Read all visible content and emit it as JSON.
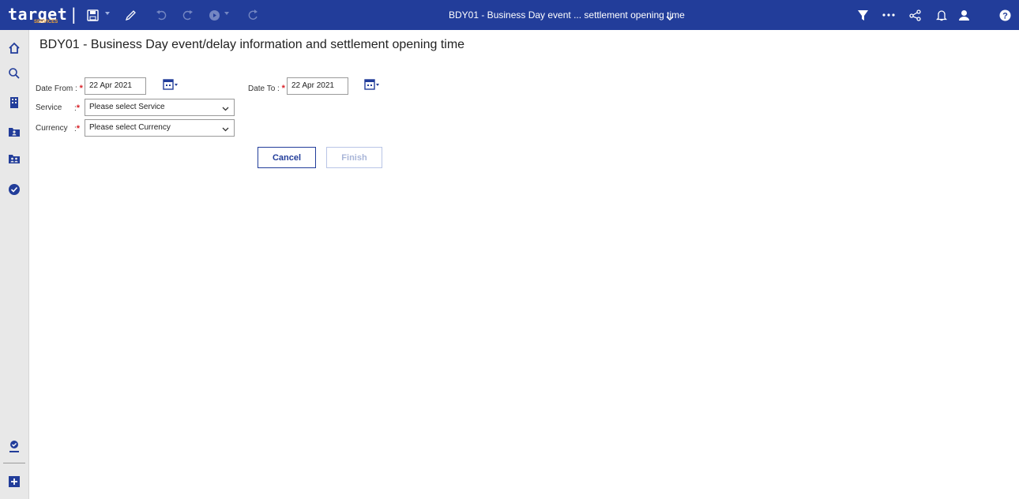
{
  "app": {
    "brand": "target",
    "brand_sub": "SERVICES",
    "window_title": "BDY01 - Business Day event ... settlement opening time"
  },
  "toolbar": {
    "icons": [
      "save-icon",
      "edit-icon",
      "undo-icon",
      "redo-icon",
      "record-icon",
      "refresh-icon"
    ],
    "right_icons": [
      "filter-icon",
      "more-icon",
      "share-icon",
      "bell-icon",
      "user-icon",
      "help-icon"
    ]
  },
  "sidebar": {
    "items": [
      "home-icon",
      "search-icon",
      "building-icon",
      "folder-person-icon",
      "folder-people-icon",
      "check-circle-icon"
    ],
    "bottom_items": [
      "user-badge-icon",
      "add-icon"
    ]
  },
  "page": {
    "title": "BDY01 - Business Day event/delay information and settlement opening time"
  },
  "form": {
    "date_from_label": "Date From :",
    "date_from_value": "22 Apr 2021",
    "date_to_label": "Date To :",
    "date_to_value": "22 Apr 2021",
    "service_label": "Service",
    "service_colon": ":",
    "service_placeholder": "Please select Service",
    "currency_label": "Currency",
    "currency_colon": ":",
    "currency_placeholder": "Please select Currency",
    "required_mark": "*"
  },
  "buttons": {
    "cancel": "Cancel",
    "finish": "Finish"
  },
  "colors": {
    "topbar": "#223d9a",
    "accent": "#223d9a",
    "required": "#d9232a",
    "brand_sub": "#f0a437"
  }
}
